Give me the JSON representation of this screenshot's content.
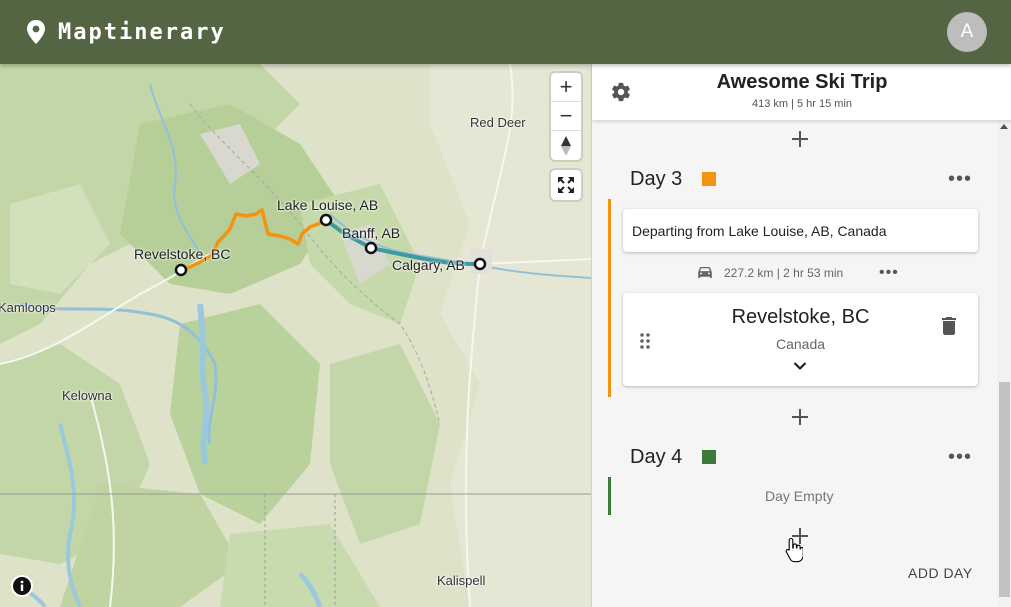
{
  "app": {
    "name": "Maptinerary",
    "avatar_initial": "A"
  },
  "map": {
    "labels": {
      "red_deer": "Red Deer",
      "kamloops": "Kamloops",
      "kelowna": "Kelowna",
      "kalispell": "Kalispell"
    },
    "stops": {
      "lake_louise": "Lake Louise, AB",
      "banff": "Banff, AB",
      "revelstoke": "Revelstoke, BC",
      "calgary": "Calgary, AB"
    },
    "controls": {
      "zoom_in": "+",
      "zoom_out": "−"
    },
    "route_colors": {
      "day3": "#f5920f",
      "day_prev": "#3e9aa0"
    }
  },
  "trip": {
    "title": "Awesome Ski Trip",
    "stats": "413 km | 5 hr 15 min",
    "days": [
      {
        "title": "Day 3",
        "color": "#f5920f",
        "departing": "Departing from Lake Louise, AB, Canada",
        "leg": "227.2 km | 2 hr 53 min",
        "stop": {
          "name": "Revelstoke, BC",
          "country": "Canada"
        }
      },
      {
        "title": "Day 4",
        "color": "#3d7a3a",
        "empty": "Day Empty"
      }
    ],
    "add_day_label": "ADD DAY"
  }
}
